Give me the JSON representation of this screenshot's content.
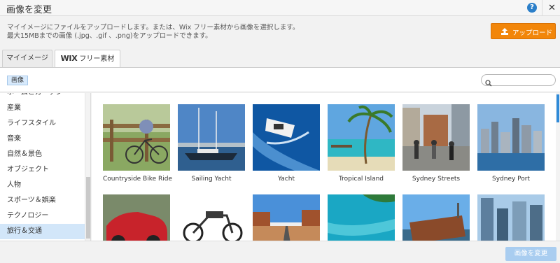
{
  "window": {
    "title": "画像を変更",
    "help_label": "?",
    "close_label": "✕"
  },
  "description": {
    "line1": "マイイメージにファイルをアップロードします。または、Wix フリー素材から画像を選択します。",
    "line2": "最大15MBまでの画像 (.jpg、.gif 、.png)をアップロードできます。"
  },
  "upload_button": {
    "label": "アップロード",
    "icon": "upload-icon"
  },
  "tabs": [
    {
      "label": "マイイメージ"
    },
    {
      "brand": "WIX",
      "label": "フリー素材"
    }
  ],
  "filter": {
    "chip": "画像"
  },
  "search": {
    "placeholder": "",
    "icon": "search-icon"
  },
  "sidebar": {
    "partial_item": "ホームとガーデン",
    "items": [
      {
        "label": "産業"
      },
      {
        "label": "ライフスタイル"
      },
      {
        "label": "音楽"
      },
      {
        "label": "自然＆景色"
      },
      {
        "label": "オブジェクト"
      },
      {
        "label": "人物"
      },
      {
        "label": "スポーツ＆娯楽"
      },
      {
        "label": "テクノロジー"
      },
      {
        "label": "旅行＆交通",
        "active": true
      }
    ]
  },
  "images": [
    {
      "caption": "Countryside Bike Ride"
    },
    {
      "caption": "Sailing Yacht"
    },
    {
      "caption": "Yacht"
    },
    {
      "caption": "Tropical Island"
    },
    {
      "caption": "Sydney Streets"
    },
    {
      "caption": "Sydney Port"
    }
  ],
  "footer": {
    "apply_label": "画像を変更"
  },
  "colors": {
    "accent_orange": "#f2860a",
    "selection_blue": "#d2e6f9",
    "apply_disabled": "#a9cdf0"
  }
}
